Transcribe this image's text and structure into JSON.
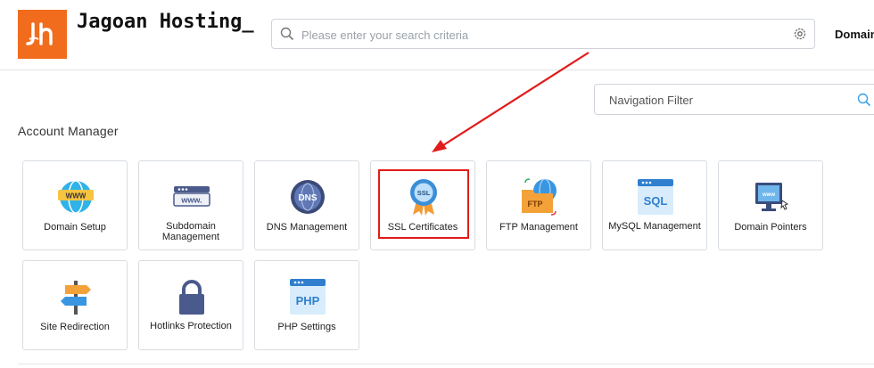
{
  "brand": {
    "name": "Jagoan Hosting_",
    "color": "#f26c1d"
  },
  "header": {
    "search_placeholder": "Please enter your search criteria",
    "domain_link": "Domain"
  },
  "nav_filter": {
    "placeholder": "Navigation Filter"
  },
  "section": {
    "title": "Account Manager",
    "tiles": [
      {
        "label": "Domain Setup",
        "icon": "www-globe-icon"
      },
      {
        "label": "Subdomain Management",
        "icon": "www-bar-icon"
      },
      {
        "label": "DNS Management",
        "icon": "dns-globe-icon"
      },
      {
        "label": "SSL Certificates",
        "icon": "ssl-badge-icon",
        "highlighted": true
      },
      {
        "label": "FTP Management",
        "icon": "ftp-folder-icon"
      },
      {
        "label": "MySQL Management",
        "icon": "sql-window-icon"
      },
      {
        "label": "Domain Pointers",
        "icon": "monitor-www-icon"
      },
      {
        "label": "Site Redirection",
        "icon": "signpost-icon"
      },
      {
        "label": "Hotlinks Protection",
        "icon": "padlock-icon"
      },
      {
        "label": "PHP Settings",
        "icon": "php-window-icon"
      }
    ]
  },
  "annotation": {
    "highlight_color": "#e21b1b"
  }
}
